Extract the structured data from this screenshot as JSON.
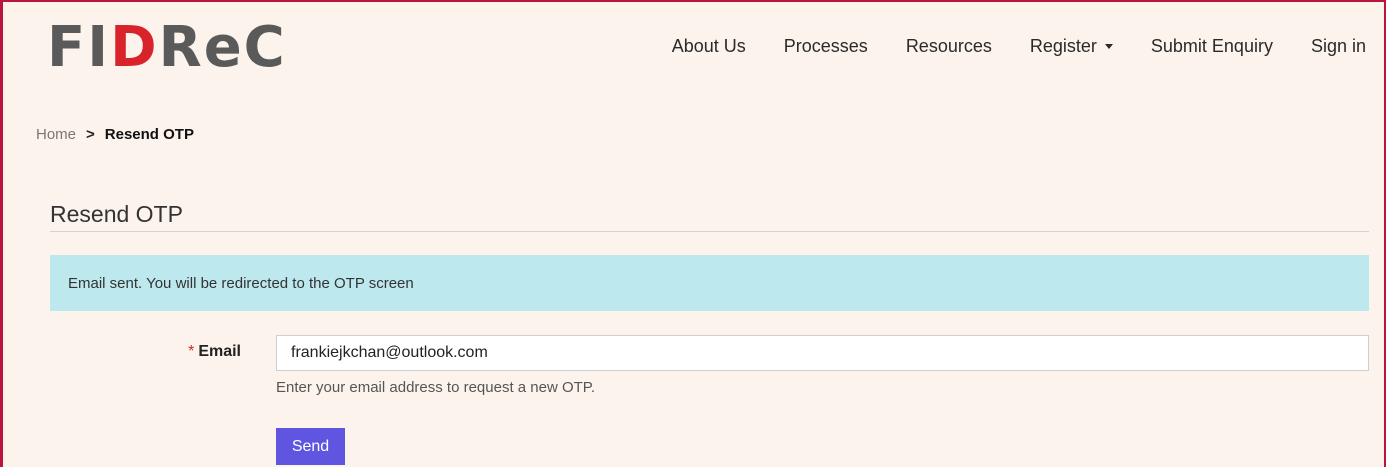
{
  "header": {
    "logo": {
      "part1": "FI",
      "part2": "D",
      "part3": "ReC"
    },
    "nav": [
      {
        "label": "About Us"
      },
      {
        "label": "Processes"
      },
      {
        "label": "Resources"
      },
      {
        "label": "Register",
        "has_dropdown": true
      },
      {
        "label": "Submit Enquiry"
      },
      {
        "label": "Sign in"
      }
    ]
  },
  "breadcrumb": {
    "home": "Home",
    "separator": ">",
    "current": "Resend OTP"
  },
  "page": {
    "title": "Resend OTP"
  },
  "alert": {
    "message": "Email sent. You will be redirected to the OTP screen"
  },
  "form": {
    "required_marker": "*",
    "email_label": "Email",
    "email_value": "frankiejkchan@outlook.com",
    "help_text": "Enter your email address to request a new OTP.",
    "send_label": "Send"
  },
  "colors": {
    "accent": "#5f55e0",
    "brand_red": "#d8232a",
    "alert_bg": "#bde8ee",
    "page_bg": "#fcf4ec"
  }
}
